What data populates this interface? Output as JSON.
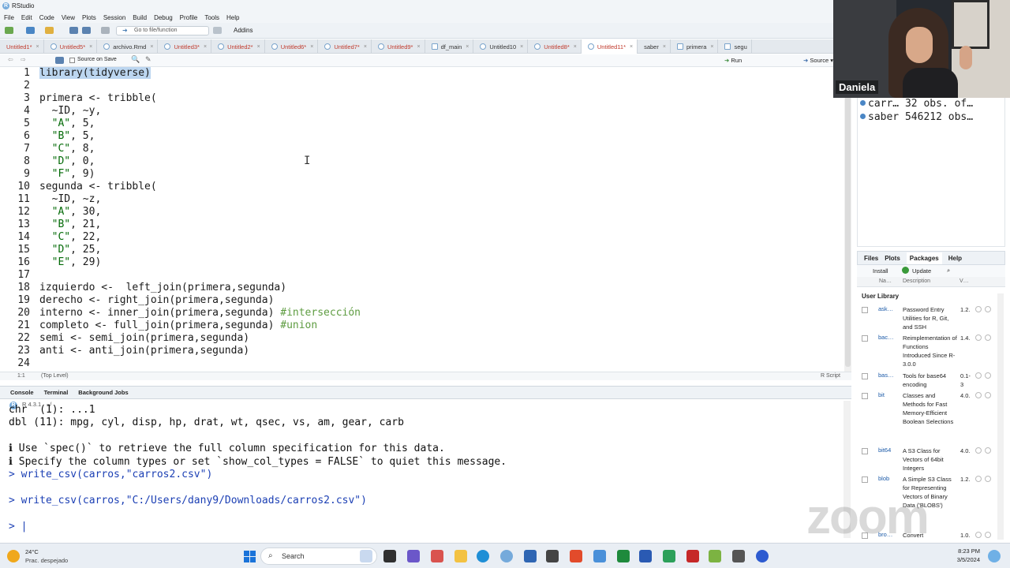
{
  "window": {
    "title": "RStudio"
  },
  "menu": [
    "File",
    "Edit",
    "Code",
    "View",
    "Plots",
    "Session",
    "Build",
    "Debug",
    "Profile",
    "Tools",
    "Help"
  ],
  "toolbar": {
    "goto_placeholder": "Go to file/function",
    "addins": "Addins"
  },
  "tabs": [
    {
      "label": "Untitled1*",
      "modified": true
    },
    {
      "label": "Untitled5*",
      "modified": true
    },
    {
      "label": "archivo.Rmd",
      "modified": false
    },
    {
      "label": "Untitled3*",
      "modified": true
    },
    {
      "label": "Untitled2*",
      "modified": true
    },
    {
      "label": "Untitled6*",
      "modified": true
    },
    {
      "label": "Untitled7*",
      "modified": true
    },
    {
      "label": "Untitled9*",
      "modified": true
    },
    {
      "label": "df_main",
      "modified": false
    },
    {
      "label": "Untitled10",
      "modified": false
    },
    {
      "label": "Untitled8*",
      "modified": true
    },
    {
      "label": "Untitled11*",
      "modified": true,
      "active": true
    },
    {
      "label": "saber",
      "modified": false
    },
    {
      "label": "primera",
      "modified": false
    },
    {
      "label": "segu",
      "modified": false
    }
  ],
  "editor_toolbar": {
    "source_on_save": "Source on Save",
    "run": "Run",
    "source": "Source"
  },
  "code_lines": [
    "library(tidyverse)",
    "",
    "primera <- tribble(",
    "  ~ID, ~y,",
    "  \"A\", 5,",
    "  \"B\", 5,",
    "  \"C\", 8,",
    "  \"D\", 0,",
    "  \"F\", 9)",
    "segunda <- tribble(",
    "  ~ID, ~z,",
    "  \"A\", 30,",
    "  \"B\", 21,",
    "  \"C\", 22,",
    "  \"D\", 25,",
    "  \"E\", 29)",
    "",
    "izquierdo <-  left_join(primera,segunda)",
    "derecho <- right_join(primera,segunda)",
    "interno <- inner_join(primera,segunda) #intersección",
    "completo <- full_join(primera,segunda) #union",
    "semi <- semi_join(primera,segunda)",
    "anti <- anti_join(primera,segunda)",
    ""
  ],
  "editor_status": {
    "position": "1:1",
    "scope": "(Top Level)",
    "filetype": "R Script"
  },
  "console": {
    "tabs": [
      "Console",
      "Terminal",
      "Background Jobs"
    ],
    "version_path": "R 4.3.1 · ~/",
    "lines": [
      {
        "text": "chr  (1): ...1",
        "style": "normal"
      },
      {
        "text": "dbl (11): mpg, cyl, disp, hp, drat, wt, qsec, vs, am, gear, carb",
        "style": "normal"
      },
      {
        "text": "",
        "style": "normal"
      },
      {
        "text": "ℹ Use `spec()` to retrieve the full column specification for this data.",
        "style": "info"
      },
      {
        "text": "ℹ Specify the column types or set `show_col_types = FALSE` to quiet this message.",
        "style": "info"
      },
      {
        "text": "> write_csv(carros,\"carros2.csv\")",
        "style": "blue"
      },
      {
        "text": "",
        "style": "normal"
      },
      {
        "text": "> write_csv(carros,\"C:/Users/dany9/Downloads/carros2.csv\")",
        "style": "blue"
      },
      {
        "text": "",
        "style": "normal"
      },
      {
        "text": "> |",
        "style": "blue"
      }
    ]
  },
  "environment": [
    {
      "name": "carr…",
      "value": "32 obs. of…"
    },
    {
      "name": "saber",
      "value": "546212 obs…"
    }
  ],
  "files_pane": {
    "tabs": [
      "Files",
      "Plots",
      "Packages",
      "Help"
    ],
    "install": "Install",
    "update": "Update",
    "headers": [
      "Na…",
      "Description",
      "V…"
    ],
    "section": "User Library",
    "packages": [
      {
        "name": "ask…",
        "desc": "Password Entry Utilities for R, Git, and SSH",
        "ver": "1.2."
      },
      {
        "name": "bac…",
        "desc": "Reimplementation of Functions Introduced Since R-3.0.0",
        "ver": "1.4."
      },
      {
        "name": "bas…",
        "desc": "Tools for base64 encoding",
        "ver": "0.1-3"
      },
      {
        "name": "bit",
        "desc": "Classes and Methods for Fast Memory-Efficient Boolean Selections",
        "ver": "4.0."
      },
      {
        "name": "bit64",
        "desc": "A S3 Class for Vectors of 64bit Integers",
        "ver": "4.0."
      },
      {
        "name": "blob",
        "desc": "A Simple S3 Class for Representing Vectors of Binary Data ('BLOBS')",
        "ver": "1.2."
      },
      {
        "name": "bro…",
        "desc": "Convert",
        "ver": "1.0."
      }
    ]
  },
  "webcam": {
    "participant": "Daniela"
  },
  "watermark": "zoom",
  "taskbar": {
    "weather_temp": "24°C",
    "weather_desc": "Prac. despejado",
    "search": "Search",
    "time": "8:23 PM",
    "date": "3/5/2024"
  },
  "colors": {
    "string": "#036a07",
    "comment": "#5e9c41",
    "console_cmd": "#1b3fb4",
    "selection": "#bcd6f0",
    "accent": "#75aadb"
  }
}
